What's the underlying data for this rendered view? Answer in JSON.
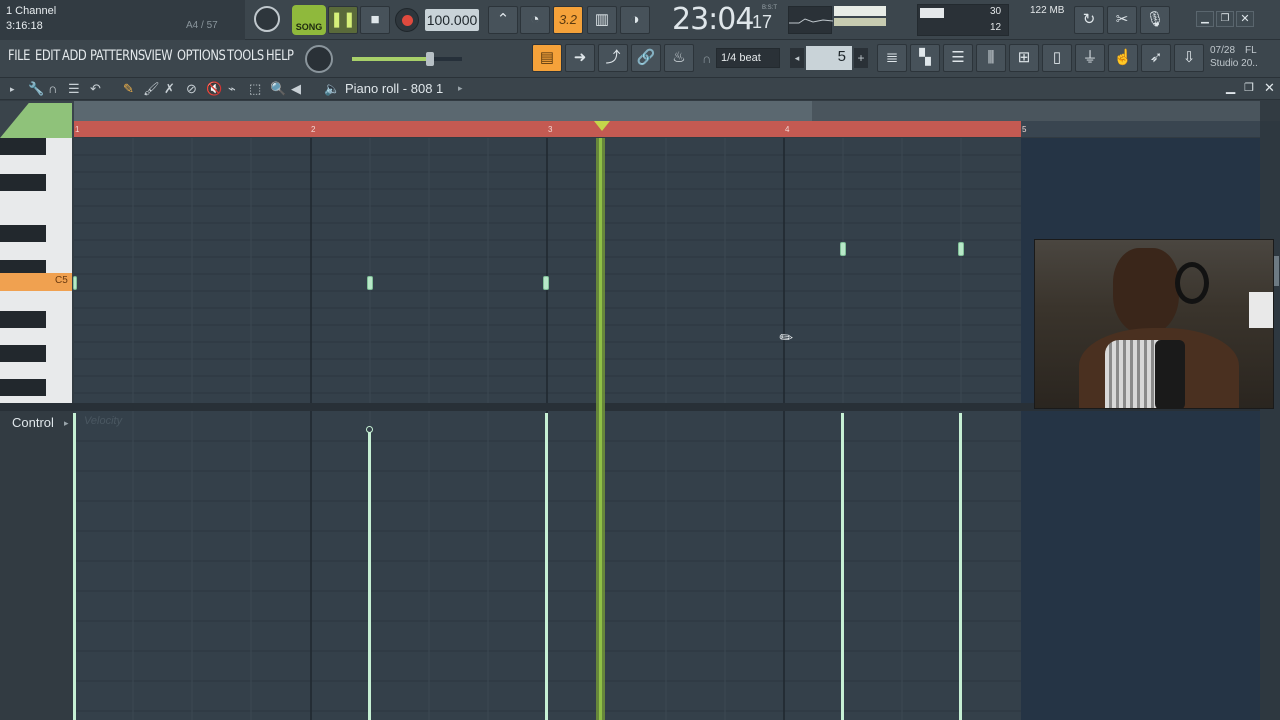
{
  "window": {
    "channel_title": "1 Channel",
    "time_hint": "3:16:18",
    "note_hint": "A4 / 57"
  },
  "transport": {
    "song_label": "SONG",
    "tempo": "100.000",
    "pattern_num": "3.2",
    "time_main": "23:04",
    "time_sub": "17",
    "time_tag": "B:S:T",
    "cpu": "30",
    "ram": "122 MB",
    "poly": "12"
  },
  "menu": {
    "items": [
      "FILE",
      "EDIT",
      "ADD",
      "PATTERNS",
      "VIEW",
      "OPTIONS",
      "TOOLS",
      "HELP"
    ]
  },
  "snap": {
    "label": "1/4 beat",
    "step_value": "5"
  },
  "hint_bar": {
    "date": "07/28",
    "app": "FL",
    "app_sub": "Studio 20.."
  },
  "piano_roll": {
    "title": "Piano roll - 808 1",
    "ruler_bars": [
      "1",
      "2",
      "3",
      "4",
      "5"
    ],
    "key_label": "C5",
    "control_label": "Control",
    "control_sub": "Velocity"
  },
  "colors": {
    "accent": "#f5a23a",
    "ruler": "#c45a52",
    "playhead": "#8fc046",
    "note": "#b8e8c8"
  }
}
